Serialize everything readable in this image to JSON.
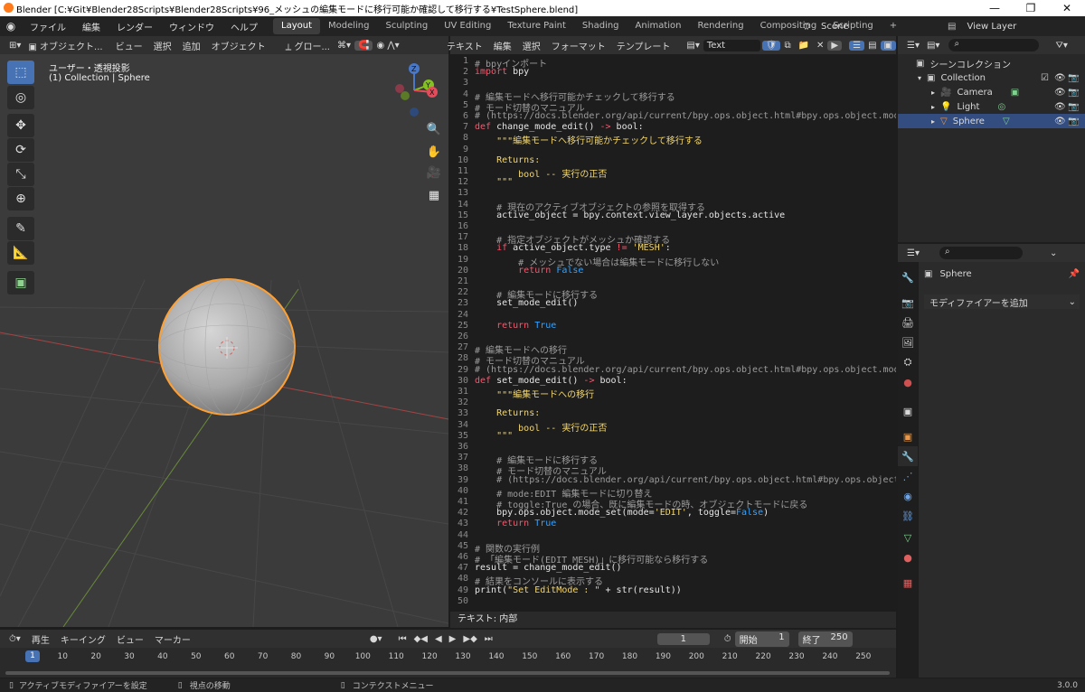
{
  "window": {
    "title": "Blender [C:¥Git¥Blender28Scripts¥Blender28Scripts¥96_メッシュの編集モードに移行可能か確認して移行する¥TestSphere.blend]",
    "minimize": "—",
    "restore": "❐",
    "close": "✕"
  },
  "topbar": {
    "menus": [
      "ファイル",
      "編集",
      "レンダー",
      "ウィンドウ",
      "ヘルプ"
    ],
    "workspaces": [
      "Layout",
      "Modeling",
      "Sculpting",
      "UV Editing",
      "Texture Paint",
      "Shading",
      "Animation",
      "Rendering",
      "Compositing",
      "Scripting"
    ],
    "active_workspace": "Layout",
    "add_tab": "+",
    "scene": "Scene",
    "view_layer": "View Layer"
  },
  "viewport": {
    "header": {
      "mode": "オブジェクト...",
      "menus": [
        "ビュー",
        "選択",
        "追加",
        "オブジェクト"
      ],
      "orientation": "グロー..."
    },
    "overlay_title": "ユーザー・透視投影",
    "overlay_sub": "(1) Collection | Sphere",
    "gizmo": {
      "z": "Z",
      "y": "Y",
      "x": "X"
    }
  },
  "text_editor": {
    "menus": [
      "テキスト",
      "編集",
      "選択",
      "フォーマット",
      "テンプレート"
    ],
    "datablock": "Text",
    "footer": "テキスト: 内部",
    "lines": [
      [
        {
          "t": "# bpyインポート",
          "c": "cm"
        }
      ],
      [
        {
          "t": "import",
          "c": "kw"
        },
        {
          "t": " bpy",
          "c": ""
        }
      ],
      [],
      [
        {
          "t": "# 編集モードへ移行可能かチェックして移行する",
          "c": "cm"
        }
      ],
      [
        {
          "t": "# モード切替のマニュアル",
          "c": "cm"
        }
      ],
      [
        {
          "t": "# (https://docs.blender.org/api/current/bpy.ops.object.html#bpy.ops.object.mode_set)",
          "c": "cm"
        }
      ],
      [
        {
          "t": "def",
          "c": "kw"
        },
        {
          "t": " change_mode_edit() ",
          "c": ""
        },
        {
          "t": "->",
          "c": "kw"
        },
        {
          "t": " bool:",
          "c": ""
        }
      ],
      [
        {
          "t": "    \"\"\"編集モードへ移行可能かチェックして移行する",
          "c": "st"
        }
      ],
      [],
      [
        {
          "t": "    Returns:",
          "c": "st"
        }
      ],
      [
        {
          "t": "        bool -- 実行の正否",
          "c": "st"
        }
      ],
      [
        {
          "t": "    \"\"\"",
          "c": "st"
        }
      ],
      [],
      [
        {
          "t": "    # 現在のアクティブオブジェクトの参照を取得する",
          "c": "cm"
        }
      ],
      [
        {
          "t": "    active_object = bpy.context.view_layer.objects.active",
          "c": ""
        }
      ],
      [],
      [
        {
          "t": "    # 指定オブジェクトがメッシュか確認する",
          "c": "cm"
        }
      ],
      [
        {
          "t": "    if",
          "c": "kw"
        },
        {
          "t": " active_object.type ",
          "c": ""
        },
        {
          "t": "!=",
          "c": "kw"
        },
        {
          "t": " ",
          "c": ""
        },
        {
          "t": "'MESH'",
          "c": "st"
        },
        {
          "t": ":",
          "c": ""
        }
      ],
      [
        {
          "t": "        # メッシュでない場合は編集モードに移行しない",
          "c": "cm"
        }
      ],
      [
        {
          "t": "        return",
          "c": "kw"
        },
        {
          "t": " ",
          "c": ""
        },
        {
          "t": "False",
          "c": "bi"
        }
      ],
      [],
      [
        {
          "t": "    # 編集モードに移行する",
          "c": "cm"
        }
      ],
      [
        {
          "t": "    set_mode_edit()",
          "c": ""
        }
      ],
      [],
      [
        {
          "t": "    return",
          "c": "kw"
        },
        {
          "t": " ",
          "c": ""
        },
        {
          "t": "True",
          "c": "bi"
        }
      ],
      [],
      [
        {
          "t": "# 編集モードへの移行",
          "c": "cm"
        }
      ],
      [
        {
          "t": "# モード切替のマニュアル",
          "c": "cm"
        }
      ],
      [
        {
          "t": "# (https://docs.blender.org/api/current/bpy.ops.object.html#bpy.ops.object.mode_set)",
          "c": "cm"
        }
      ],
      [
        {
          "t": "def",
          "c": "kw"
        },
        {
          "t": " set_mode_edit() ",
          "c": ""
        },
        {
          "t": "->",
          "c": "kw"
        },
        {
          "t": " bool:",
          "c": ""
        }
      ],
      [
        {
          "t": "    \"\"\"編集モードへの移行",
          "c": "st"
        }
      ],
      [],
      [
        {
          "t": "    Returns:",
          "c": "st"
        }
      ],
      [
        {
          "t": "        bool -- 実行の正否",
          "c": "st"
        }
      ],
      [
        {
          "t": "    \"\"\"",
          "c": "st"
        }
      ],
      [],
      [
        {
          "t": "    # 編集モードに移行する",
          "c": "cm"
        }
      ],
      [
        {
          "t": "    # モード切替のマニュアル",
          "c": "cm"
        }
      ],
      [
        {
          "t": "    # (https://docs.blender.org/api/current/bpy.ops.object.html#bpy.ops.object.mode_se",
          "c": "cm"
        }
      ],
      [
        {
          "t": "    # mode:EDIT 編集モードに切り替え",
          "c": "cm"
        }
      ],
      [
        {
          "t": "    # toggle:True の場合、既に編集モードの時、オブジェクトモードに戻る",
          "c": "cm"
        }
      ],
      [
        {
          "t": "    bpy.ops.object.mode_set(mode=",
          "c": ""
        },
        {
          "t": "'EDIT'",
          "c": "st"
        },
        {
          "t": ", toggle=",
          "c": ""
        },
        {
          "t": "False",
          "c": "bi"
        },
        {
          "t": ")",
          "c": ""
        }
      ],
      [
        {
          "t": "    return",
          "c": "kw"
        },
        {
          "t": " ",
          "c": ""
        },
        {
          "t": "True",
          "c": "bi"
        }
      ],
      [],
      [
        {
          "t": "# 関数の実行例",
          "c": "cm"
        }
      ],
      [
        {
          "t": "# 「編集モード(EDIT MESH)」に移行可能なら移行する",
          "c": "cm"
        }
      ],
      [
        {
          "t": "result = change_mode_edit()",
          "c": ""
        }
      ],
      [
        {
          "t": "# 結果をコンソールに表示する",
          "c": "cm"
        }
      ],
      [
        {
          "t": "print(",
          "c": ""
        },
        {
          "t": "\"Set EditMode : \"",
          "c": "st"
        },
        {
          "t": " + str(result))",
          "c": ""
        }
      ],
      []
    ]
  },
  "outliner": {
    "scene_collection": "シーンコレクション",
    "items": [
      {
        "label": "Collection",
        "icon": "collection-icon"
      },
      {
        "label": "Camera",
        "icon": "camera-icon"
      },
      {
        "label": "Light",
        "icon": "light-icon"
      },
      {
        "label": "Sphere",
        "icon": "mesh-icon",
        "selected": true
      }
    ]
  },
  "properties": {
    "object": "Sphere",
    "add_modifier": "モディファイアーを追加"
  },
  "timeline": {
    "menus": [
      "再生",
      "キーイング",
      "ビュー",
      "マーカー"
    ],
    "current_frame": "1",
    "start_label": "開始",
    "start": "1",
    "end_label": "終了",
    "end": "250",
    "frames": [
      "1",
      "10",
      "20",
      "30",
      "40",
      "50",
      "60",
      "70",
      "80",
      "90",
      "100",
      "110",
      "120",
      "130",
      "140",
      "150",
      "160",
      "170",
      "180",
      "190",
      "200",
      "210",
      "220",
      "230",
      "240",
      "250"
    ]
  },
  "statusbar": {
    "left": "アクティブモディファイアーを設定",
    "mid": "視点の移動",
    "right": "コンテクストメニュー",
    "version": "3.0.0"
  },
  "colors": {
    "accent": "#4772b3",
    "selection": "#ffa033",
    "active_tab": "#3d3d3d"
  }
}
